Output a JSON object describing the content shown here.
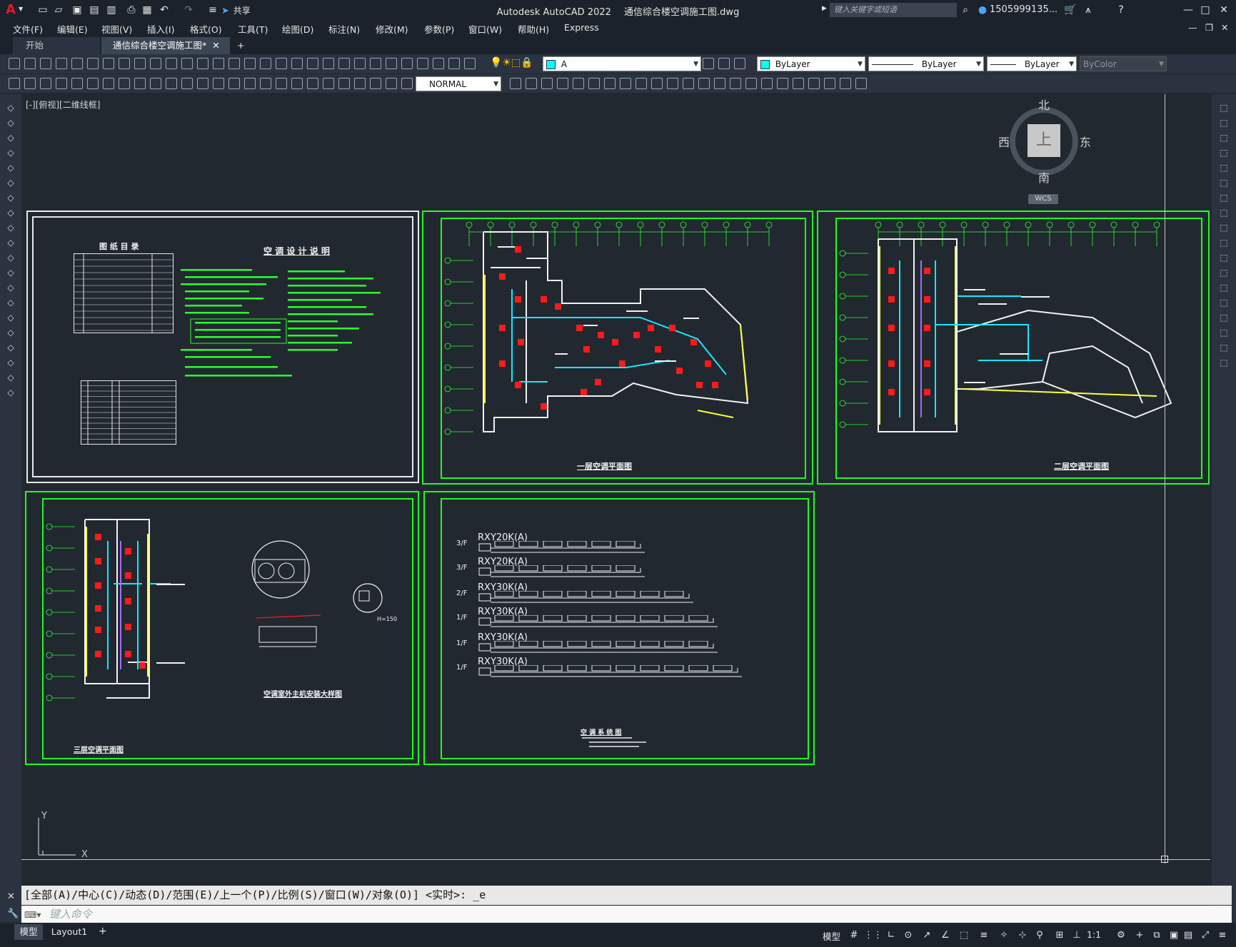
{
  "app": {
    "title": "Autodesk AutoCAD 2022",
    "document_title": "通信综合楼空调施工图.dwg",
    "share_label": "共享",
    "search_placeholder": "键入关键字或短语",
    "user": "1505999135...",
    "app_letter": "A"
  },
  "menu": [
    "文件(F)",
    "编辑(E)",
    "视图(V)",
    "插入(I)",
    "格式(O)",
    "工具(T)",
    "绘图(D)",
    "标注(N)",
    "修改(M)",
    "参数(P)",
    "窗口(W)",
    "帮助(H)",
    "Express"
  ],
  "tabs": [
    {
      "label": "开始",
      "active": false
    },
    {
      "label": "通信综合楼空调施工图*",
      "active": true
    }
  ],
  "toolbar": {
    "layer_value": "A",
    "color_value": "ByLayer",
    "linetype_value": "ByLayer",
    "lineweight_value": "ByLayer",
    "plotstyle_value": "ByColor",
    "dimstyle_value": "NORMAL"
  },
  "viewport_label": "[-][俯视][二维线框]",
  "viewcube": {
    "north": "北",
    "south": "南",
    "east": "东",
    "west": "西",
    "top": "上",
    "wcs": "WCS"
  },
  "drawing": {
    "sheet1": {
      "index_title": "图 纸 目 录",
      "notes_title": "空 调 设 计 说 明"
    },
    "sheet2_title": "一层空调平面图",
    "sheet3_title": "二层空调平面图",
    "sheet4": {
      "plan_title": "三层空调平面图",
      "detail_title": "空调室外主机安装大样图",
      "detail_label": "H=150"
    },
    "sheet5": {
      "system_title": "空 调 系 统 图",
      "rows": [
        {
          "floor": "3/F",
          "model": "RXY20K(A)",
          "units": 6
        },
        {
          "floor": "3/F",
          "model": "RXY20K(A)",
          "units": 6
        },
        {
          "floor": "2/F",
          "model": "RXY30K(A)",
          "units": 8
        },
        {
          "floor": "1/F",
          "model": "RXY30K(A)",
          "units": 9
        },
        {
          "floor": "1/F",
          "model": "RXY30K(A)",
          "units": 9
        },
        {
          "floor": "1/F",
          "model": "RXY30K(A)",
          "units": 10
        }
      ]
    },
    "ucs": {
      "y": "Y",
      "x": "X"
    }
  },
  "command": {
    "history": "[全部(A)/中心(C)/动态(D)/范围(E)/上一个(P)/比例(S)/窗口(W)/对象(O)] <实时>: _e",
    "placeholder": "键入命令"
  },
  "layout_tabs": [
    "模型",
    "Layout1"
  ],
  "status": {
    "model_label": "模型",
    "scale": "1:1"
  },
  "colors": {
    "frame_green": "#1eff1e",
    "equipment_red": "#ff1a1a",
    "duct_cyan": "#19e6ff",
    "wall_yellow": "#ffff33",
    "background": "#212830"
  }
}
